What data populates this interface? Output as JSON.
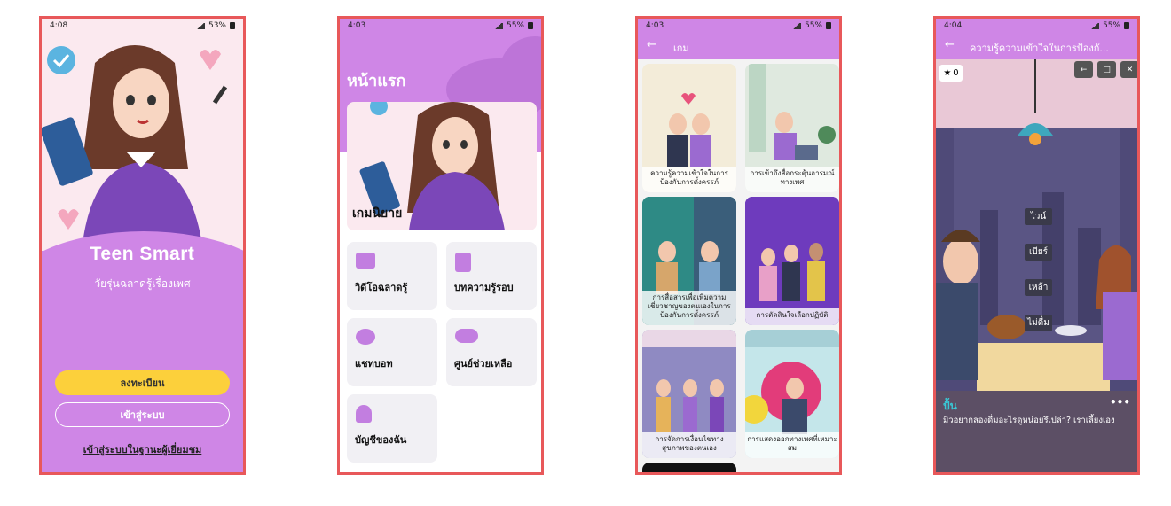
{
  "screens": [
    {
      "status": {
        "time": "4:08",
        "battery": "53%"
      },
      "app_title": "Teen Smart",
      "subtitle": "วัยรุ่นฉลาดรู้เรื่องเพศ",
      "register_label": "ลงทะเบียน",
      "login_label": "เข้าสู่ระบบ",
      "guest_label": "เข้าสู่ระบบในฐานะผู้เยี่ยมชม"
    },
    {
      "status": {
        "time": "4:03",
        "battery": "55%"
      },
      "page_title": "หน้าแรก",
      "banner_title": "เกมนิยาย",
      "menu": [
        {
          "label": "วิดีโอฉลาดรู้",
          "icon": "video-icon"
        },
        {
          "label": "บทความรู้รอบ",
          "icon": "article-icon"
        },
        {
          "label": "แชทบอท",
          "icon": "chat-icon"
        },
        {
          "label": "ศูนย์ช่วยเหลือ",
          "icon": "group-icon"
        },
        {
          "label": "บัญชีของฉัน",
          "icon": "person-icon"
        }
      ]
    },
    {
      "status": {
        "time": "4:03",
        "battery": "55%"
      },
      "page_title": "เกม",
      "games": [
        {
          "title": "ความรู้ความเข้าใจในการป้องกันการตั้งครรภ์",
          "color": "#e8efe0"
        },
        {
          "title": "การเข้าถึงสื่อกระตุ้นอารมณ์ทางเพศ",
          "color": "#e3ede6"
        },
        {
          "title": "การสื่อสารเพื่อเพิ่มความเชี่ยวชาญของตนเองในการป้องกันการตั้งครรภ์",
          "color": "#2e8a85"
        },
        {
          "title": "การตัดสินใจเลือกปฏิบัติ",
          "color": "#6e3bbd"
        },
        {
          "title": "การจัดการเงื่อนไขทางสุขภาพของตนเอง",
          "color": "#8f8ac2"
        },
        {
          "title": "การแสดงออกทางเพศที่เหมาะสม",
          "color": "#c4e6ea"
        }
      ]
    },
    {
      "status": {
        "time": "4:04",
        "battery": "55%"
      },
      "page_title": "ความรู้ความเข้าใจในการป้องกั...",
      "score": "0",
      "choices": [
        "ไวน์",
        "เบียร์",
        "เหล้า",
        "ไม่ดื่ม"
      ],
      "speaker": "ปั้น",
      "dialogue": "มิวอยากลองดื่มอะไรดูหน่อยรึเปล่า? เราเลี้ยงเอง",
      "more": "•••"
    }
  ]
}
